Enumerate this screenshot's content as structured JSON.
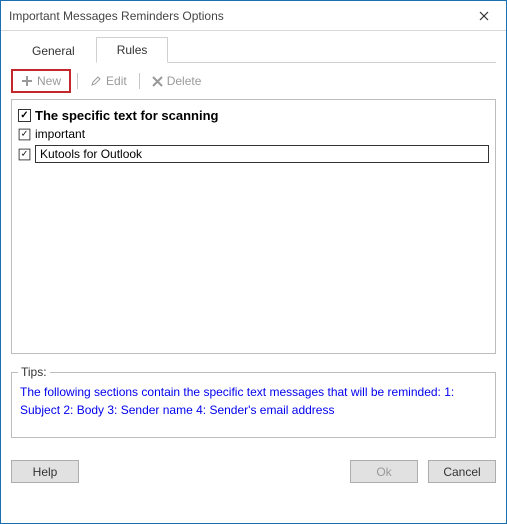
{
  "window": {
    "title": "Important Messages Reminders Options"
  },
  "tabs": {
    "general": "General",
    "rules": "Rules",
    "active": "rules"
  },
  "toolbar": {
    "new_label": "New",
    "edit_label": "Edit",
    "delete_label": "Delete"
  },
  "rules": {
    "header_label": "The specific text for scanning",
    "header_checked": true,
    "items": [
      {
        "checked": true,
        "text": "important",
        "editable": false
      },
      {
        "checked": true,
        "text": "Kutools for Outlook",
        "editable": true
      }
    ]
  },
  "tips": {
    "label": "Tips:",
    "text": "The following sections contain the specific text messages that will be reminded: 1: Subject 2: Body 3: Sender name 4: Sender's email address"
  },
  "footer": {
    "help": "Help",
    "ok": "Ok",
    "cancel": "Cancel"
  }
}
